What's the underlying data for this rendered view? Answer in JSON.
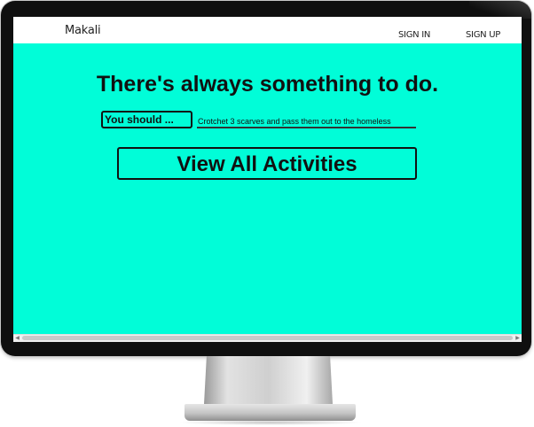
{
  "navbar": {
    "brand": "Makali",
    "links": [
      {
        "label": "SIGN IN"
      },
      {
        "label": "SIGN UP"
      }
    ]
  },
  "main": {
    "headline": "There's always something to do.",
    "suggest_button_label": "You should ...",
    "activity_field_value": "Crotchet 3 scarves and pass them out to the homeless",
    "view_all_button_label": "View All Activities"
  },
  "colors": {
    "background_accent": "#01fdd8",
    "text": "#111111",
    "navbar_background": "#ffffff"
  },
  "icons": {
    "scroll_left": "scroll-left-arrow-icon",
    "scroll_right": "scroll-right-arrow-icon"
  }
}
